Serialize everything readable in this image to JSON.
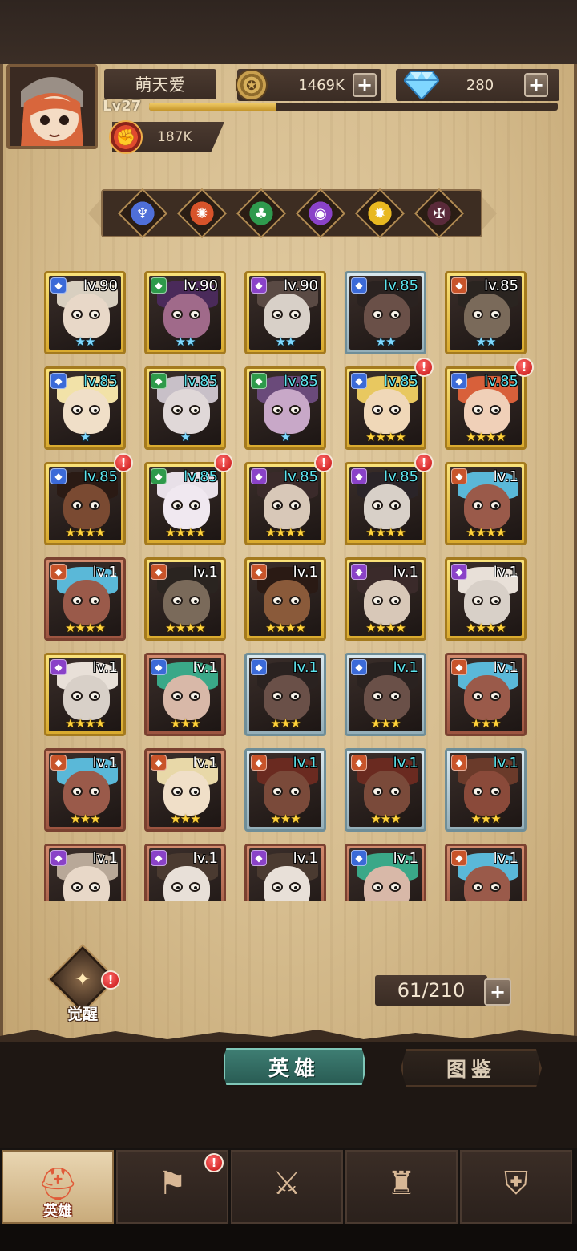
{
  "player": {
    "name": "萌天爱",
    "level_label": "Lv27",
    "xp_progress": 0.31,
    "power": "187K"
  },
  "resources": {
    "gold": "1469K",
    "gems": "280"
  },
  "faction_filters": [
    {
      "name": "light",
      "color": "#4f6fd8",
      "glyph": "♆"
    },
    {
      "name": "fire",
      "color": "#d8532a",
      "glyph": "✺"
    },
    {
      "name": "nature",
      "color": "#2f9a4e",
      "glyph": "♣"
    },
    {
      "name": "arcane",
      "color": "#8a42c8",
      "glyph": "◉"
    },
    {
      "name": "sun",
      "color": "#e8b820",
      "glyph": "✹"
    },
    {
      "name": "shadow",
      "color": "#5a2a3a",
      "glyph": "✠"
    }
  ],
  "heroes": [
    {
      "level": "lv.90",
      "frame": "gold",
      "class_color": "#3b6ad8",
      "stars": "★★",
      "star_color": "blue",
      "alert": false,
      "skin": "#e8d8c8",
      "hair": "#d8cfc0"
    },
    {
      "level": "lv.90",
      "frame": "gold",
      "class_color": "#2e9a4a",
      "stars": "★★",
      "star_color": "blue",
      "alert": false,
      "skin": "#a06a8a",
      "hair": "#4a2a5a"
    },
    {
      "level": "lv.90",
      "frame": "gold",
      "class_color": "#8a42c8",
      "stars": "★★",
      "star_color": "blue",
      "alert": false,
      "skin": "#d8d0c8",
      "hair": "#5a4a44"
    },
    {
      "level": "lv.85",
      "frame": "silver",
      "class_color": "#3b6ad8",
      "stars": "★★",
      "star_color": "blue",
      "alert": false,
      "skin": "#6a5048",
      "hair": "#2a2220"
    },
    {
      "level": "lv.85",
      "frame": "gold",
      "class_color": "#c8542a",
      "stars": "★★",
      "star_color": "blue",
      "alert": false,
      "skin": "#7a6a5a",
      "hair": "#2a2420"
    },
    {
      "level": "lv.85",
      "frame": "gold",
      "class_color": "#3b6ad8",
      "stars": "★",
      "star_color": "blue",
      "alert": false,
      "skin": "#f0dfc8",
      "hair": "#f2e2a8"
    },
    {
      "level": "lv.85",
      "frame": "gold",
      "class_color": "#2e9a4a",
      "stars": "★",
      "star_color": "blue",
      "alert": false,
      "skin": "#e0d8d8",
      "hair": "#c8c0c8"
    },
    {
      "level": "lv.85",
      "frame": "gold",
      "class_color": "#2e9a4a",
      "stars": "★",
      "star_color": "blue",
      "alert": false,
      "skin": "#c8a8c8",
      "hair": "#6a4a7a"
    },
    {
      "level": "lv.85",
      "frame": "gold",
      "class_color": "#3b6ad8",
      "stars": "★★★★",
      "star_color": "gold",
      "alert": true,
      "skin": "#f0d8b8",
      "hair": "#e8c860"
    },
    {
      "level": "lv.85",
      "frame": "gold",
      "class_color": "#3b6ad8",
      "stars": "★★★★",
      "star_color": "gold",
      "alert": true,
      "skin": "#f0d0b8",
      "hair": "#d8603a"
    },
    {
      "level": "lv.85",
      "frame": "gold",
      "class_color": "#3b6ad8",
      "stars": "★★★★",
      "star_color": "gold",
      "alert": true,
      "skin": "#7a4a32",
      "hair": "#2a1a14"
    },
    {
      "level": "lv.85",
      "frame": "gold",
      "class_color": "#2e9a4a",
      "stars": "★★★★",
      "star_color": "gold",
      "alert": true,
      "skin": "#f0e8f0",
      "hair": "#e8e0e8"
    },
    {
      "level": "lv.85",
      "frame": "gold",
      "class_color": "#8a42c8",
      "stars": "★★★★",
      "star_color": "gold",
      "alert": true,
      "skin": "#d8c8b8",
      "hair": "#3a2a2a"
    },
    {
      "level": "lv.85",
      "frame": "gold",
      "class_color": "#8a42c8",
      "stars": "★★★★",
      "star_color": "gold",
      "alert": true,
      "skin": "#d8d0c8",
      "hair": "#2a2428"
    },
    {
      "level": "lv.1",
      "frame": "gold",
      "class_color": "#c8542a",
      "stars": "★★★★",
      "star_color": "gold",
      "alert": false,
      "skin": "#9a5a4a",
      "hair": "#5ab8d8"
    },
    {
      "level": "lv.1",
      "frame": "bronze",
      "class_color": "#c8542a",
      "stars": "★★★★",
      "star_color": "gold",
      "alert": false,
      "skin": "#9a5a4a",
      "hair": "#5ab8d8"
    },
    {
      "level": "lv.1",
      "frame": "gold",
      "class_color": "#c8542a",
      "stars": "★★★★",
      "star_color": "gold",
      "alert": false,
      "skin": "#7a6a5a",
      "hair": "#2a2420"
    },
    {
      "level": "lv.1",
      "frame": "gold",
      "class_color": "#c8542a",
      "stars": "★★★★",
      "star_color": "gold",
      "alert": false,
      "skin": "#8a5a3a",
      "hair": "#2a1a14"
    },
    {
      "level": "lv.1",
      "frame": "gold",
      "class_color": "#8a42c8",
      "stars": "★★★★",
      "star_color": "gold",
      "alert": false,
      "skin": "#d8c8b8",
      "hair": "#3a2a2a"
    },
    {
      "level": "lv.1",
      "frame": "gold",
      "class_color": "#8a42c8",
      "stars": "★★★★",
      "star_color": "gold",
      "alert": false,
      "skin": "#d8d0c8",
      "hair": "#e8e0d8"
    },
    {
      "level": "lv.1",
      "frame": "gold",
      "class_color": "#8a42c8",
      "stars": "★★★★",
      "star_color": "gold",
      "alert": false,
      "skin": "#d8d0c8",
      "hair": "#e8e0d8"
    },
    {
      "level": "lv.1",
      "frame": "bronze",
      "class_color": "#3b6ad8",
      "stars": "★★★",
      "star_color": "gold",
      "alert": false,
      "skin": "#d8b8a8",
      "hair": "#3aa888"
    },
    {
      "level": "lv.1",
      "frame": "silver",
      "class_color": "#3b6ad8",
      "stars": "★★★",
      "star_color": "gold",
      "alert": false,
      "skin": "#6a5048",
      "hair": "#2a2220"
    },
    {
      "level": "lv.1",
      "frame": "silver",
      "class_color": "#3b6ad8",
      "stars": "★★★",
      "star_color": "gold",
      "alert": false,
      "skin": "#6a5048",
      "hair": "#2a2220"
    },
    {
      "level": "lv.1",
      "frame": "bronze",
      "class_color": "#c8542a",
      "stars": "★★★",
      "star_color": "gold",
      "alert": false,
      "skin": "#9a5a4a",
      "hair": "#5ab8d8"
    },
    {
      "level": "lv.1",
      "frame": "bronze",
      "class_color": "#c8542a",
      "stars": "★★★",
      "star_color": "gold",
      "alert": false,
      "skin": "#9a5a4a",
      "hair": "#5ab8d8"
    },
    {
      "level": "lv.1",
      "frame": "bronze",
      "class_color": "#c8542a",
      "stars": "★★★",
      "star_color": "gold",
      "alert": false,
      "skin": "#f0dfc8",
      "hair": "#e8d8a8"
    },
    {
      "level": "lv.1",
      "frame": "silver",
      "class_color": "#c8542a",
      "stars": "★★★",
      "star_color": "gold",
      "alert": false,
      "skin": "#7a4a3a",
      "hair": "#6a2a20"
    },
    {
      "level": "lv.1",
      "frame": "silver",
      "class_color": "#c8542a",
      "stars": "★★★",
      "star_color": "gold",
      "alert": false,
      "skin": "#7a4a3a",
      "hair": "#6a2a20"
    },
    {
      "level": "lv.1",
      "frame": "silver",
      "class_color": "#c8542a",
      "stars": "★★★",
      "star_color": "gold",
      "alert": false,
      "skin": "#8a4a3a",
      "hair": "#6a3a2a"
    },
    {
      "level": "lv.1",
      "frame": "bronze",
      "class_color": "#8a42c8",
      "stars": "",
      "star_color": "gold",
      "alert": false,
      "skin": "#e8d8c8",
      "hair": "#b8a898"
    },
    {
      "level": "lv.1",
      "frame": "bronze",
      "class_color": "#8a42c8",
      "stars": "",
      "star_color": "gold",
      "alert": false,
      "skin": "#e8e0d8",
      "hair": "#4a3a30"
    },
    {
      "level": "lv.1",
      "frame": "bronze",
      "class_color": "#8a42c8",
      "stars": "",
      "star_color": "gold",
      "alert": false,
      "skin": "#e8e0d8",
      "hair": "#4a3a30"
    },
    {
      "level": "lv.1",
      "frame": "bronze",
      "class_color": "#3b6ad8",
      "stars": "",
      "star_color": "gold",
      "alert": false,
      "skin": "#d8b8a8",
      "hair": "#3aa888"
    },
    {
      "level": "lv.1",
      "frame": "bronze",
      "class_color": "#c8542a",
      "stars": "",
      "star_color": "gold",
      "alert": false,
      "skin": "#9a5a4a",
      "hair": "#5ab8d8"
    }
  ],
  "alert_badge": "!",
  "awaken": {
    "label": "觉醒"
  },
  "hero_count": "61/210",
  "tabs": {
    "heroes": "英雄",
    "codex": "图鉴"
  },
  "bottom_nav": [
    {
      "label": "英雄",
      "icon": "helmet-icon",
      "glyph": "⛑",
      "active": true,
      "alert": false
    },
    {
      "label": "",
      "icon": "battle-flag-icon",
      "glyph": "⚑",
      "active": false,
      "alert": true
    },
    {
      "label": "",
      "icon": "crossed-swords-icon",
      "glyph": "⚔",
      "active": false,
      "alert": false
    },
    {
      "label": "",
      "icon": "castle-icon",
      "glyph": "♜",
      "active": false,
      "alert": false
    },
    {
      "label": "",
      "icon": "guild-shield-icon",
      "glyph": "⛨",
      "active": false,
      "alert": false
    }
  ]
}
